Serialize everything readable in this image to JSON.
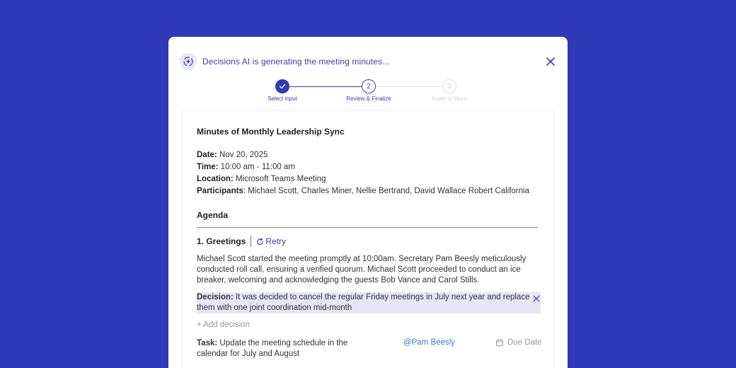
{
  "header": {
    "text": "Decisions AI is generating the meeting minutes..."
  },
  "stepper": {
    "steps": [
      {
        "number": "",
        "label": "Select input",
        "state": "complete"
      },
      {
        "number": "2",
        "label": "Review & Finalize",
        "state": "active"
      },
      {
        "number": "3",
        "label": "Insert in Word",
        "state": "pending"
      }
    ]
  },
  "minutes": {
    "title": "Minutes of Monthly Leadership Sync",
    "date_label": "Date:",
    "date_value": " Nov 20, 2025",
    "time_label": "Time:",
    "time_value": " 10:00 am - 11:00 am",
    "location_label": "Location:",
    "location_value": " Microsoft Teams Meeting",
    "participants_label": "Participants",
    "participants_value": ": Michael Scott, Charles Miner, Nellie Bertrand, David Wallace Robert California",
    "agenda_label": "Agenda",
    "item": {
      "title": "1. Greetings",
      "retry_label": "Retry",
      "paragraph": "Michael Scott started the meeting promptly at 10:00am. Secretary Pam Beesly meticulously conducted roll call, ensuring a verified quorum. Michael Scott proceeded to conduct an ice breaker, welcoming and acknowledging the guests Bob Vance and Carol Stills.",
      "decision_label": "Decision:",
      "decision_text": " It was decided to cancel the regular Friday meetings in July next year and replace them with one joint coordination mid-month",
      "add_decision": "+ Add decision",
      "task_label": "Task:",
      "task_text": " Update the meeting schedule in the calendar for July and August",
      "assignee": "@Pam Beesly",
      "due_date": "Due Date"
    }
  },
  "colors": {
    "background": "#2f38b6",
    "accent": "#3a3fa8",
    "decision_highlight": "#e6e6f7",
    "mention": "#2f7bd6"
  }
}
